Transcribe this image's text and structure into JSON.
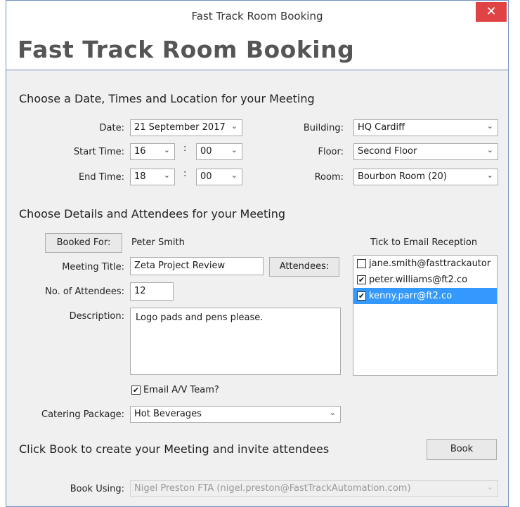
{
  "window": {
    "title": "Fast Track Room Booking",
    "close_glyph": "✕"
  },
  "header": {
    "title": "Fast Track Room Booking"
  },
  "section1": {
    "title": "Choose a Date, Times and Location for your Meeting"
  },
  "date": {
    "label": "Date:",
    "value": "21 September 2017"
  },
  "start_time": {
    "label": "Start Time:",
    "hour": "16",
    "minute": "00"
  },
  "end_time": {
    "label": "End Time:",
    "hour": "18",
    "minute": "00"
  },
  "time_sep": ":",
  "building": {
    "label": "Building:",
    "value": "HQ Cardiff"
  },
  "floor": {
    "label": "Floor:",
    "value": "Second Floor"
  },
  "room": {
    "label": "Room:",
    "value": "Bourbon Room (20)"
  },
  "section2": {
    "title": "Choose Details and Attendees for your Meeting"
  },
  "booked_for": {
    "button": "Booked For:",
    "value": "Peter Smith"
  },
  "meeting_title": {
    "label": "Meeting Title:",
    "value": "Zeta Project Review"
  },
  "attendees_button": "Attendees:",
  "num_attendees": {
    "label": "No. of Attendees:",
    "value": "12"
  },
  "description": {
    "label": "Description:",
    "value": "Logo pads and pens please."
  },
  "email_av": {
    "label": "Email A/V Team?",
    "checked": true
  },
  "catering": {
    "label": "Catering Package:",
    "value": "Hot Beverages"
  },
  "reception": {
    "label": "Tick to Email Reception",
    "items": [
      {
        "email": "jane.smith@fasttrackautor",
        "checked": false,
        "selected": false
      },
      {
        "email": "peter.williams@ft2.co",
        "checked": true,
        "selected": false
      },
      {
        "email": "kenny.parr@ft2.co",
        "checked": true,
        "selected": true
      }
    ]
  },
  "section3": {
    "title": "Click Book to create your Meeting and invite attendees"
  },
  "book_button": "Book",
  "book_using": {
    "label": "Book Using:",
    "value": "Nigel Preston FTA (nigel.preston@FastTrackAutomation.com)"
  },
  "check_glyph": "✔",
  "dropdown_glyph": "⌄"
}
